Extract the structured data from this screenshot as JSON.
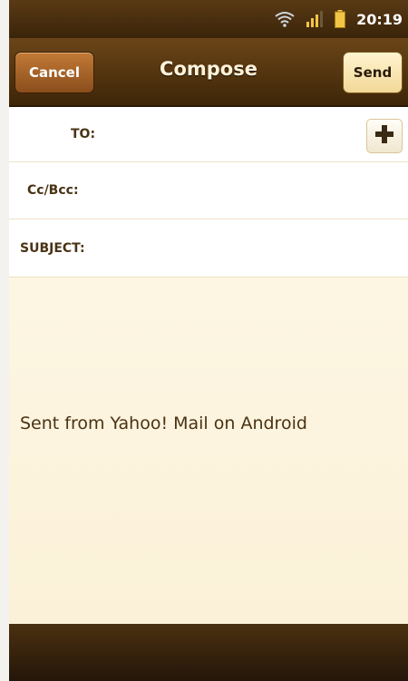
{
  "status_bar": {
    "time": "20:19",
    "icons": [
      "wifi-icon",
      "signal-icon",
      "battery-icon"
    ]
  },
  "header": {
    "cancel_label": "Cancel",
    "title": "Compose",
    "send_label": "Send"
  },
  "form": {
    "to_label": "TO:",
    "to_value": "",
    "cc_label": "Cc/Bcc:",
    "cc_value": "",
    "subject_label": "SUBJECT:",
    "subject_value": "",
    "add_contact_icon": "plus-icon"
  },
  "body": {
    "signature": "Sent from Yahoo! Mail on Android"
  },
  "colors": {
    "header_brown": "#5a3a14",
    "send_button": "#f6e3ad",
    "cancel_button": "#b0692c",
    "body_background": "#fcf4de"
  }
}
